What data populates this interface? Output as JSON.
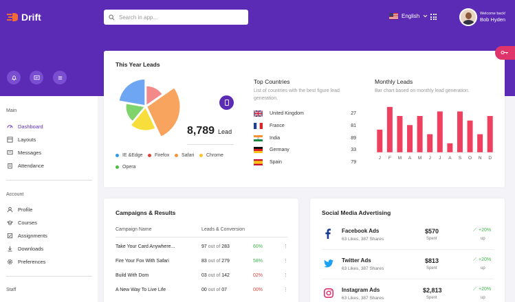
{
  "header": {
    "logo_text": "Drift",
    "search_placeholder": "Search in app...",
    "language": "English",
    "welcome": "Welcome back!",
    "user_name": "Bob Hyden"
  },
  "sidebar": {
    "sections": [
      {
        "title": "Main",
        "items": [
          "Dashboard",
          "Layouts",
          "Messages",
          "Attendance"
        ]
      },
      {
        "title": "Account",
        "items": [
          "Profile",
          "Courses",
          "Assignments",
          "Downloads",
          "Preferences"
        ]
      },
      {
        "title": "Staff",
        "items": []
      }
    ]
  },
  "leads": {
    "title": "This Year Leads",
    "count": "8,789",
    "count_label": "Lead",
    "legend": [
      {
        "label": "IE &Edge",
        "color": "#2f9be8"
      },
      {
        "label": "Firefox",
        "color": "#e0433a"
      },
      {
        "label": "Safari",
        "color": "#f5913a"
      },
      {
        "label": "Chrome",
        "color": "#f7c32e"
      },
      {
        "label": "Opera",
        "color": "#4cbf43"
      }
    ],
    "pie_colors": [
      "#6ea6f3",
      "#f28a8a",
      "#f9a45e",
      "#f7de3a",
      "#7ed36b"
    ]
  },
  "countries": {
    "title": "Top Countries",
    "subtitle": "List of countries with the best figure lead generation.",
    "rows": [
      {
        "name": "United Kingdom",
        "value": "27"
      },
      {
        "name": "France",
        "value": "81"
      },
      {
        "name": "India",
        "value": "89"
      },
      {
        "name": "Germany",
        "value": "33"
      },
      {
        "name": "Spain",
        "value": "79"
      }
    ]
  },
  "monthly": {
    "title": "Monthly Leads",
    "subtitle": "Bar chart based on monthly lead generation."
  },
  "chart_data": {
    "type": "bar",
    "categories": [
      "J",
      "F",
      "M",
      "A",
      "M",
      "J",
      "J",
      "A",
      "S",
      "O",
      "N",
      "D"
    ],
    "values": [
      5,
      10,
      8,
      6,
      8,
      4,
      9,
      2,
      9,
      7,
      4,
      8
    ],
    "ylim": [
      0,
      10
    ],
    "color": "#f0405f"
  },
  "campaigns": {
    "title": "Campaigns & Results",
    "col1": "Campaign Name",
    "col2": "Leads & Conversion",
    "rows": [
      {
        "name": "Take Your Card Anywhere...",
        "a": "97",
        "of": "out of",
        "b": "283",
        "pct": "60%",
        "color": "#3bb54a"
      },
      {
        "name": "Fire Your Fox With Safari",
        "a": "83",
        "of": "out of",
        "b": "279",
        "pct": "58%",
        "color": "#3bb54a"
      },
      {
        "name": "Build With Dom",
        "a": "03",
        "of": "out of",
        "b": "142",
        "pct": "02%",
        "color": "#e0433a"
      },
      {
        "name": "A New Way To Live Life",
        "a": "00",
        "of": "out of",
        "b": "07",
        "pct": "00%",
        "color": "#e0433a"
      }
    ]
  },
  "social": {
    "title": "Social Media Advertising",
    "rows": [
      {
        "name": "Facebook Ads",
        "stats": "63 Likes, 387 Shares",
        "amount": "$570",
        "spent": "Spent",
        "change": "+20%",
        "trend": "up"
      },
      {
        "name": "Twitter Ads",
        "stats": "63 Likes, 387 Shares",
        "amount": "$813",
        "spent": "Spent",
        "change": "+20%",
        "trend": "up"
      },
      {
        "name": "Instagram Ads",
        "stats": "63 Likes, 387 Shares",
        "amount": "$2,813",
        "spent": "Spent",
        "change": "+20%",
        "trend": "up"
      }
    ]
  }
}
